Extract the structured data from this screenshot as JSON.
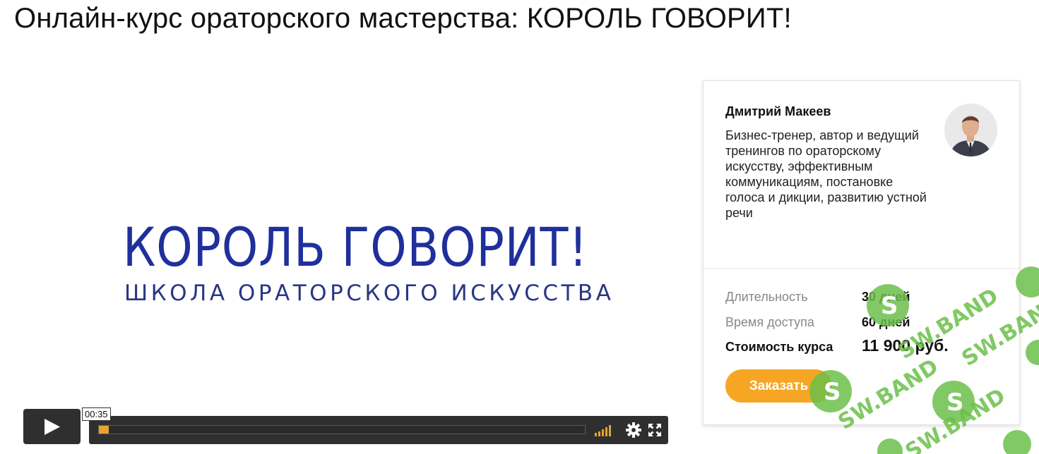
{
  "page": {
    "title": "Онлайн-курс ораторского мастерства: КОРОЛЬ ГОВОРИТ!"
  },
  "video": {
    "logo_title": "КОРОЛЬ ГОВОРИТ!",
    "logo_subtitle": "ШКОЛА ОРАТОРСКОГО ИСКУССТВА",
    "time_tooltip": "00:35",
    "progress_fraction": 0.002,
    "icons": [
      "play-icon",
      "volume-icon",
      "gear-icon",
      "fullscreen-icon"
    ],
    "accent_color": "#e8a32e"
  },
  "instructor": {
    "name": "Дмитрий Макеев",
    "bio": "Бизнес-тренер, автор и ведущий тренингов по ораторскому искусству, эффективным коммуникациям, постановке голоса и дикции, развитию устной речи"
  },
  "course_info": {
    "duration_label": "Длительность",
    "duration_value": "30 дней",
    "access_label": "Время доступа",
    "access_value": "60 дней",
    "price_label": "Стоимость курса",
    "price_value": "11 900 руб."
  },
  "actions": {
    "order_label": "Заказать",
    "order_color": "#f6a623"
  },
  "watermark": {
    "text": "SW.BAND",
    "color": "#6cc04a"
  }
}
